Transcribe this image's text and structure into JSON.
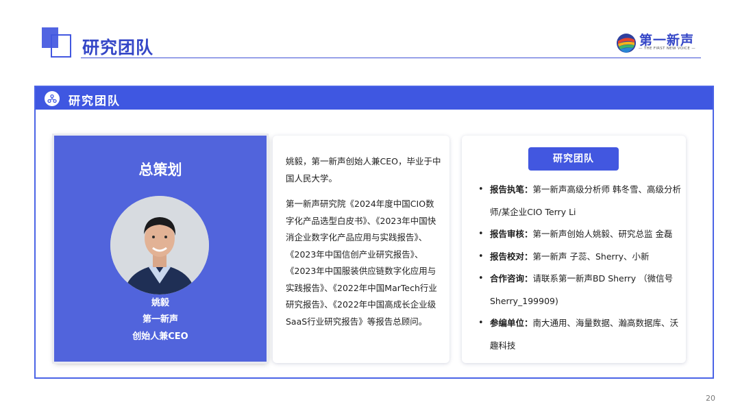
{
  "header": {
    "title": "研究团队",
    "logo_text": "第一新声",
    "logo_sub": "— THE FIRST NEW VOICE —"
  },
  "section": {
    "title": "研究团队",
    "icon": "team-icon"
  },
  "profile": {
    "role": "总策划",
    "name": "姚毅",
    "org": "第一新声",
    "position": "创始人兼CEO"
  },
  "bio": {
    "intro": "姚毅，第一新声创始人兼CEO，毕业于中国人民大学。",
    "works": "第一新声研究院《2024年度中国CIO数字化产品选型白皮书》、《2023年中国快消企业数字化产品应用与实践报告》、《2023年中国信创产业研究报告》、《2023年中国服装供应链数字化应用与实践报告》、《2022年中国MarTech行业研究报告》、《2022年中国高成长企业级SaaS行业研究报告》等报告总顾问。"
  },
  "team": {
    "button": "研究团队",
    "items": [
      {
        "key": "报告执笔：",
        "value": "第一新声高级分析师 韩冬雪、高级分析师/某企业CIO Terry Li"
      },
      {
        "key": "报告审核：",
        "value": "第一新声创始人姚毅、研究总监 金磊"
      },
      {
        "key": "报告校对：",
        "value": "第一新声 子蕊、Sherry、小新"
      },
      {
        "key": "合作咨询：",
        "value": "请联系第一新声BD Sherry （微信号Sherry_199909)"
      },
      {
        "key": "参编单位：",
        "value": "南大通用、海量数据、瀚高数据库、沃趣科技"
      }
    ]
  },
  "page_number": "20",
  "colors": {
    "accent": "#4257e0",
    "card_blue": "#5164dc"
  }
}
